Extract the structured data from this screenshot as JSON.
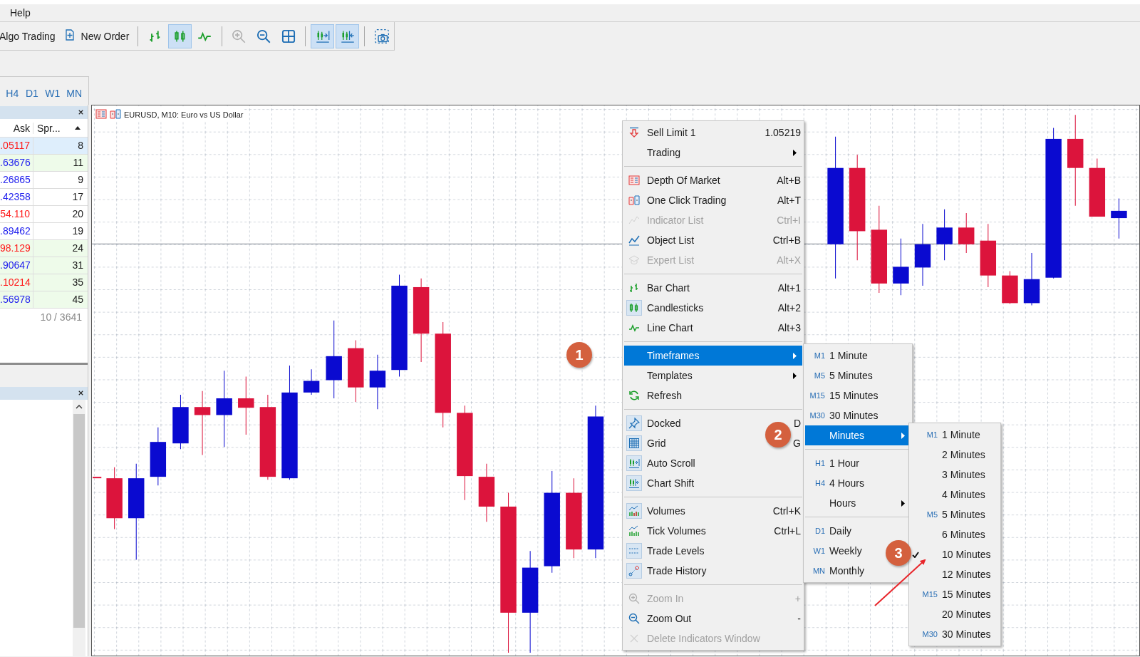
{
  "menu_bar": [
    {
      "label": "Help"
    }
  ],
  "toolbar": [
    {
      "kind": "text",
      "label": "Algo Trading"
    },
    {
      "kind": "text",
      "label": "New Order"
    },
    {
      "kind": "separator"
    },
    {
      "kind": "icon",
      "pressed": false,
      "disabled": false
    },
    {
      "kind": "icon",
      "pressed": true,
      "disabled": false
    },
    {
      "kind": "icon",
      "pressed": false,
      "disabled": false
    },
    {
      "kind": "separator"
    },
    {
      "kind": "icon",
      "pressed": false,
      "disabled": true
    },
    {
      "kind": "icon",
      "pressed": false,
      "disabled": false
    },
    {
      "kind": "icon",
      "pressed": false,
      "disabled": false
    },
    {
      "kind": "separator"
    },
    {
      "kind": "icon",
      "pressed": true,
      "disabled": false
    },
    {
      "kind": "icon",
      "pressed": true,
      "disabled": false
    },
    {
      "kind": "separator"
    },
    {
      "kind": "icon",
      "pressed": false,
      "disabled": false
    }
  ],
  "timeframe_tabs": [
    {
      "label": "H4"
    },
    {
      "label": "D1"
    },
    {
      "label": "W1"
    },
    {
      "label": "MN"
    }
  ],
  "market_watch": {
    "columns": [
      "Ask",
      "Spr..."
    ],
    "rows": [
      {
        "ask": ".05117",
        "color": "#ff1a1a",
        "spread": "8",
        "selected": true,
        "highlight": false
      },
      {
        "ask": ".63676",
        "color": "#2222ee",
        "spread": "11",
        "selected": false,
        "highlight": true
      },
      {
        "ask": ".26865",
        "color": "#2222ee",
        "spread": "9",
        "selected": false,
        "highlight": false
      },
      {
        "ask": ".42358",
        "color": "#2222ee",
        "spread": "17",
        "selected": false,
        "highlight": false
      },
      {
        "ask": "54.110",
        "color": "#ff1a1a",
        "spread": "20",
        "selected": false,
        "highlight": false
      },
      {
        "ask": ".89462",
        "color": "#2222ee",
        "spread": "19",
        "selected": false,
        "highlight": false
      },
      {
        "ask": "98.129",
        "color": "#ff1a1a",
        "spread": "24",
        "selected": false,
        "highlight": true
      },
      {
        "ask": ".90647",
        "color": "#2222ee",
        "spread": "31",
        "selected": false,
        "highlight": true
      },
      {
        "ask": ".10214",
        "color": "#ff1a1a",
        "spread": "35",
        "selected": false,
        "highlight": true
      },
      {
        "ask": ".56978",
        "color": "#2222ee",
        "spread": "45",
        "selected": false,
        "highlight": true
      }
    ],
    "footer": "10 / 3641"
  },
  "chart": {
    "title": "EURUSD, M10:  Euro vs US Dollar"
  },
  "context_menu": [
    {
      "kind": "item",
      "label": "Sell Limit 1",
      "shortcut": "1.05219",
      "disabled": false,
      "checked": false,
      "submenu": false,
      "selected": false
    },
    {
      "kind": "item",
      "label": "Trading",
      "disabled": false,
      "checked": false,
      "submenu": true,
      "selected": false
    },
    {
      "kind": "separator"
    },
    {
      "kind": "item",
      "label": "Depth Of Market",
      "shortcut": "Alt+B",
      "disabled": false,
      "checked": false,
      "submenu": false,
      "selected": false
    },
    {
      "kind": "item",
      "label": "One Click Trading",
      "shortcut": "Alt+T",
      "disabled": false,
      "checked": false,
      "submenu": false,
      "selected": false
    },
    {
      "kind": "item",
      "label": "Indicator List",
      "shortcut": "Ctrl+I",
      "disabled": true,
      "checked": false,
      "submenu": false,
      "selected": false
    },
    {
      "kind": "item",
      "label": "Object List",
      "shortcut": "Ctrl+B",
      "disabled": false,
      "checked": false,
      "submenu": false,
      "selected": false
    },
    {
      "kind": "item",
      "label": "Expert List",
      "shortcut": "Alt+X",
      "disabled": true,
      "checked": false,
      "submenu": false,
      "selected": false
    },
    {
      "kind": "separator"
    },
    {
      "kind": "item",
      "label": "Bar Chart",
      "shortcut": "Alt+1",
      "disabled": false,
      "checked": false,
      "submenu": false,
      "selected": false
    },
    {
      "kind": "item",
      "label": "Candlesticks",
      "shortcut": "Alt+2",
      "disabled": false,
      "checked": true,
      "submenu": false,
      "selected": false
    },
    {
      "kind": "item",
      "label": "Line Chart",
      "shortcut": "Alt+3",
      "disabled": false,
      "checked": false,
      "submenu": false,
      "selected": false
    },
    {
      "kind": "separator"
    },
    {
      "kind": "item",
      "label": "Timeframes",
      "disabled": false,
      "checked": false,
      "submenu": true,
      "selected": true
    },
    {
      "kind": "item",
      "label": "Templates",
      "disabled": false,
      "checked": false,
      "submenu": true,
      "selected": false
    },
    {
      "kind": "item",
      "label": "Refresh",
      "disabled": false,
      "checked": false,
      "submenu": false,
      "selected": false
    },
    {
      "kind": "separator"
    },
    {
      "kind": "item",
      "label": "Docked",
      "shortcut": "D",
      "disabled": false,
      "checked": true,
      "submenu": false,
      "selected": false
    },
    {
      "kind": "item",
      "label": "Grid",
      "shortcut": "G",
      "disabled": false,
      "checked": true,
      "submenu": false,
      "selected": false
    },
    {
      "kind": "item",
      "label": "Auto Scroll",
      "disabled": false,
      "checked": true,
      "submenu": false,
      "selected": false
    },
    {
      "kind": "item",
      "label": "Chart Shift",
      "disabled": false,
      "checked": true,
      "submenu": false,
      "selected": false
    },
    {
      "kind": "separator"
    },
    {
      "kind": "item",
      "label": "Volumes",
      "shortcut": "Ctrl+K",
      "disabled": false,
      "checked": true,
      "submenu": false,
      "selected": false
    },
    {
      "kind": "item",
      "label": "Tick Volumes",
      "shortcut": "Ctrl+L",
      "disabled": false,
      "checked": false,
      "submenu": false,
      "selected": false
    },
    {
      "kind": "item",
      "label": "Trade Levels",
      "disabled": false,
      "checked": true,
      "submenu": false,
      "selected": false
    },
    {
      "kind": "item",
      "label": "Trade History",
      "disabled": false,
      "checked": true,
      "submenu": false,
      "selected": false
    },
    {
      "kind": "separator"
    },
    {
      "kind": "item",
      "label": "Zoom In",
      "shortcut": "+",
      "disabled": true,
      "checked": false,
      "submenu": false,
      "selected": false
    },
    {
      "kind": "item",
      "label": "Zoom Out",
      "shortcut": "-",
      "disabled": false,
      "checked": false,
      "submenu": false,
      "selected": false
    },
    {
      "kind": "item",
      "label": "Delete Indicators Window",
      "disabled": true,
      "checked": false,
      "submenu": false,
      "selected": false
    }
  ],
  "timeframes_menu": [
    {
      "kind": "item",
      "code": "M1",
      "label": "1 Minute",
      "submenu": false,
      "selected": false
    },
    {
      "kind": "item",
      "code": "M5",
      "label": "5 Minutes",
      "submenu": false,
      "selected": false
    },
    {
      "kind": "item",
      "code": "M15",
      "label": "15 Minutes",
      "submenu": false,
      "selected": false
    },
    {
      "kind": "item",
      "code": "M30",
      "label": "30 Minutes",
      "submenu": false,
      "selected": false
    },
    {
      "kind": "item",
      "label": "Minutes",
      "submenu": true,
      "selected": true
    },
    {
      "kind": "separator"
    },
    {
      "kind": "item",
      "code": "H1",
      "label": "1 Hour",
      "submenu": false,
      "selected": false
    },
    {
      "kind": "item",
      "code": "H4",
      "label": "4 Hours",
      "submenu": false,
      "selected": false
    },
    {
      "kind": "item",
      "label": "Hours",
      "submenu": true,
      "selected": false
    },
    {
      "kind": "separator"
    },
    {
      "kind": "item",
      "code": "D1",
      "label": "Daily",
      "submenu": false,
      "selected": false
    },
    {
      "kind": "item",
      "code": "W1",
      "label": "Weekly",
      "submenu": false,
      "selected": false
    },
    {
      "kind": "item",
      "code": "MN",
      "label": "Monthly",
      "submenu": false,
      "selected": false
    }
  ],
  "minutes_menu": [
    {
      "code": "M1",
      "label": "1 Minute",
      "checked": false
    },
    {
      "label": "2 Minutes",
      "checked": false
    },
    {
      "label": "3 Minutes",
      "checked": false
    },
    {
      "label": "4 Minutes",
      "checked": false
    },
    {
      "code": "M5",
      "label": "5 Minutes",
      "checked": false
    },
    {
      "label": "6 Minutes",
      "checked": false
    },
    {
      "label": "10 Minutes",
      "checked": true
    },
    {
      "label": "12 Minutes",
      "checked": false
    },
    {
      "code": "M15",
      "label": "15 Minutes",
      "checked": false
    },
    {
      "label": "20 Minutes",
      "checked": false
    },
    {
      "code": "M30",
      "label": "30 Minutes",
      "checked": false
    }
  ],
  "callouts": [
    {
      "label": "1"
    },
    {
      "label": "2"
    },
    {
      "label": "3"
    }
  ]
}
